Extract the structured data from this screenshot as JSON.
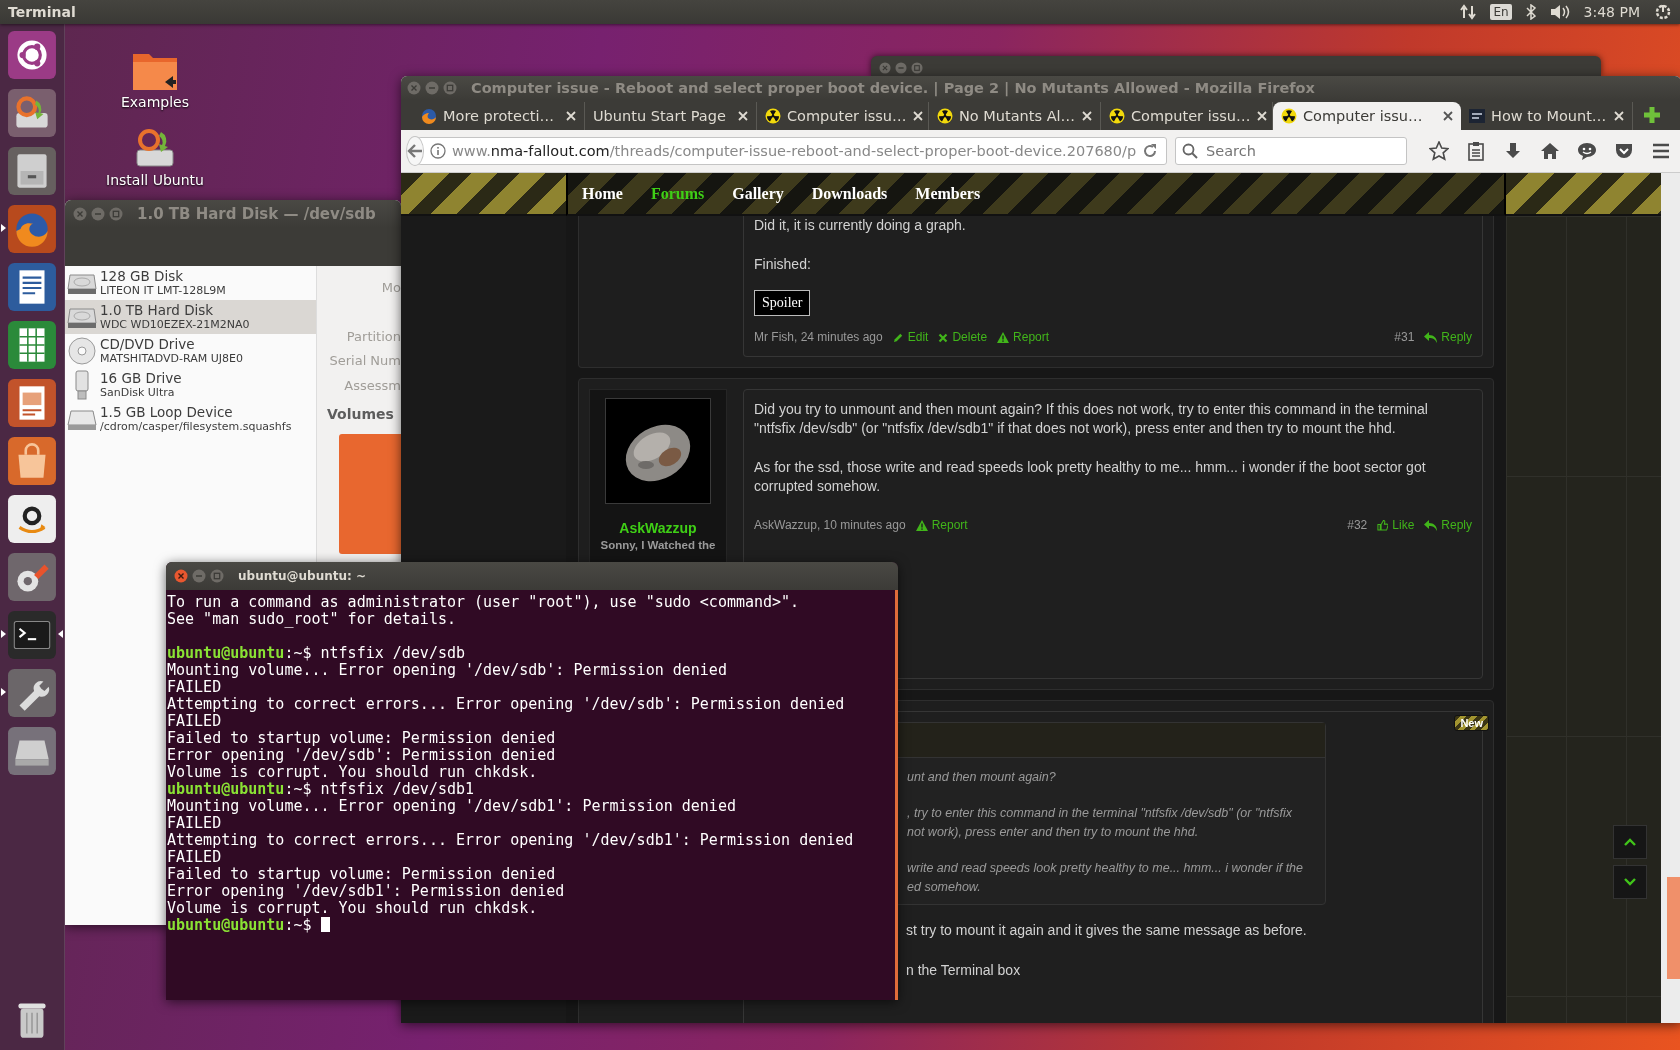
{
  "top_panel": {
    "app_name": "Terminal",
    "keyboard_layout": "En",
    "clock": "3:48 PM"
  },
  "launcher": {
    "items": [
      {
        "kind": "dash",
        "running": false,
        "focused": false
      },
      {
        "kind": "installer",
        "running": false,
        "focused": false
      },
      {
        "kind": "files",
        "running": false,
        "focused": false
      },
      {
        "kind": "browser",
        "running": true,
        "focused": false
      },
      {
        "kind": "writer",
        "running": false,
        "focused": false
      },
      {
        "kind": "calc",
        "running": false,
        "focused": false
      },
      {
        "kind": "impress",
        "running": false,
        "focused": false
      },
      {
        "kind": "software",
        "running": false,
        "focused": false
      },
      {
        "kind": "amazon",
        "running": false,
        "focused": false
      },
      {
        "kind": "settings",
        "running": false,
        "focused": false
      },
      {
        "kind": "terminal",
        "running": true,
        "focused": true
      },
      {
        "kind": "tools",
        "running": true,
        "focused": false
      },
      {
        "kind": "drive",
        "running": false,
        "focused": false
      },
      {
        "kind": "trash",
        "running": false,
        "focused": false
      }
    ]
  },
  "desktop_icons": [
    {
      "kind": "folder",
      "label": "Examples"
    },
    {
      "kind": "installer",
      "label": "Install Ubuntu"
    }
  ],
  "disks_window": {
    "title": "1.0 TB Hard Disk — /dev/sdb",
    "drives": [
      {
        "kind": "hdd",
        "name": "128 GB Disk",
        "model": "LITEON IT LMT-128L9M",
        "selected": false
      },
      {
        "kind": "hdd",
        "name": "1.0 TB Hard Disk",
        "model": "WDC WD10EZEX-21M2NA0",
        "selected": true
      },
      {
        "kind": "optical",
        "name": "CD/DVD Drive",
        "model": "MATSHITADVD-RAM UJ8E0",
        "selected": false
      },
      {
        "kind": "usb",
        "name": "16 GB Drive",
        "model": "SanDisk Ultra",
        "selected": false
      },
      {
        "kind": "loop",
        "name": "1.5 GB Loop Device",
        "model": "/cdrom/casper/filesystem.squashfs",
        "selected": false
      }
    ],
    "field_labels": [
      "Mo",
      "Partition",
      "Serial Num",
      "Assessm"
    ],
    "volumes_heading": "Volumes"
  },
  "firefox": {
    "title": "Computer issue - Reboot and select proper boot device. | Page 2 | No Mutants Allowed - Mozilla Firefox",
    "tabs": [
      {
        "label": "More protecti…",
        "kind": "browser",
        "selected": false
      },
      {
        "label": "Ubuntu Start Page",
        "kind": "plain",
        "selected": false
      },
      {
        "label": "Computer issu…",
        "kind": "radiation",
        "selected": false
      },
      {
        "label": "No Mutants Al…",
        "kind": "radiation",
        "selected": false
      },
      {
        "label": "Computer issu…",
        "kind": "radiation",
        "selected": false
      },
      {
        "label": "Computer issu…",
        "kind": "radiation",
        "selected": true
      },
      {
        "label": "How to Mount…",
        "kind": "site",
        "selected": false
      }
    ],
    "url": {
      "prefix": "www.",
      "domain": "nma-fallout.com",
      "path": "/threads/computer-issue-reboot-and-select-proper-boot-device.207680/p"
    },
    "search": {
      "placeholder": "Search"
    },
    "site_nav": [
      {
        "label": "Home",
        "selected": false
      },
      {
        "label": "Forums",
        "selected": true
      },
      {
        "label": "Gallery",
        "selected": false
      },
      {
        "label": "Downloads",
        "selected": false
      },
      {
        "label": "Members",
        "selected": false
      }
    ],
    "posts": [
      {
        "paragraphs": [
          "Did it, it is currently doing a graph.",
          "Finished:"
        ],
        "spoiler": "Spoiler",
        "meta": "Mr Fish, 24 minutes ago",
        "actions": [
          {
            "kind": "edit",
            "label": "Edit"
          },
          {
            "kind": "delete",
            "label": "Delete"
          },
          {
            "kind": "report",
            "label": "Report"
          }
        ],
        "number": "#31",
        "end_actions": [
          {
            "kind": "reply",
            "label": "Reply"
          }
        ]
      },
      {
        "user": {
          "name": "AskWazzup",
          "title": "Sonny, I Watched the"
        },
        "paragraphs": [
          "Did you try to unmount and then mount again? If this does not work, try to enter this command in the terminal \"ntfsfix /dev/sdb\" (or \"ntfsfix /dev/sdb1\" if that does not work), press enter and then try to mount the hhd.",
          "As for the ssd, those write and read speeds look pretty healthy to me... hmm... i wonder if the boot sector got corrupted somehow."
        ],
        "meta": "AskWazzup, 10 minutes ago",
        "actions": [
          {
            "kind": "report",
            "label": "Report"
          }
        ],
        "number": "#32",
        "end_actions": [
          {
            "kind": "like",
            "label": "Like"
          },
          {
            "kind": "reply",
            "label": "Reply"
          }
        ]
      },
      {
        "badge": "New",
        "quote": [
          {
            "lines": [
              "unt and then mount again?"
            ]
          },
          {
            "lines": [
              ", try to enter this command in the terminal \"ntfsfix /dev/sdb\" (or \"ntfsfix",
              " not work), press enter and then try to mount the hhd."
            ]
          },
          {
            "lines": [
              "write and read speeds look pretty healthy to me... hmm... i wonder if the",
              "ed somehow."
            ]
          }
        ],
        "paragraphs": [
          "st try to mount it again and it gives the same message as before.",
          "n the Terminal box"
        ]
      }
    ]
  },
  "terminal": {
    "title": "ubuntu@ubuntu: ~",
    "lines": [
      {
        "kind": "output",
        "text": "To run a command as administrator (user \"root\"), use \"sudo <command>\"."
      },
      {
        "kind": "output",
        "text": "See \"man sudo_root\" for details."
      },
      {
        "kind": "blank"
      },
      {
        "kind": "prompt",
        "user": "ubuntu@ubuntu",
        "path": ":~$",
        "command": "ntfsfix /dev/sdb",
        "cursor": false
      },
      {
        "kind": "output",
        "text": "Mounting volume... Error opening '/dev/sdb': Permission denied"
      },
      {
        "kind": "output",
        "text": "FAILED"
      },
      {
        "kind": "output",
        "text": "Attempting to correct errors... Error opening '/dev/sdb': Permission denied"
      },
      {
        "kind": "output",
        "text": "FAILED"
      },
      {
        "kind": "output",
        "text": "Failed to startup volume: Permission denied"
      },
      {
        "kind": "output",
        "text": "Error opening '/dev/sdb': Permission denied"
      },
      {
        "kind": "output",
        "text": "Volume is corrupt. You should run chkdsk."
      },
      {
        "kind": "prompt",
        "user": "ubuntu@ubuntu",
        "path": ":~$",
        "command": "ntfsfix /dev/sdb1",
        "cursor": false
      },
      {
        "kind": "output",
        "text": "Mounting volume... Error opening '/dev/sdb1': Permission denied"
      },
      {
        "kind": "output",
        "text": "FAILED"
      },
      {
        "kind": "output",
        "text": "Attempting to correct errors... Error opening '/dev/sdb1': Permission denied"
      },
      {
        "kind": "output",
        "text": "FAILED"
      },
      {
        "kind": "output",
        "text": "Failed to startup volume: Permission denied"
      },
      {
        "kind": "output",
        "text": "Error opening '/dev/sdb1': Permission denied"
      },
      {
        "kind": "output",
        "text": "Volume is corrupt. You should run chkdsk."
      },
      {
        "kind": "prompt",
        "user": "ubuntu@ubuntu",
        "path": ":~$",
        "cursor": true
      }
    ]
  }
}
